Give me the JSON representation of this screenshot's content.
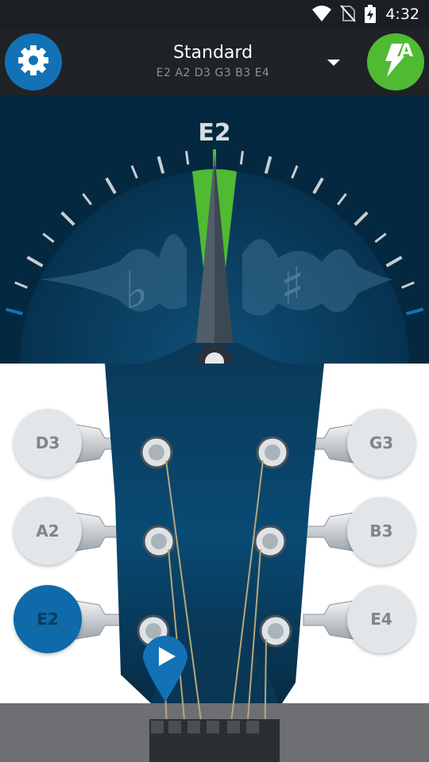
{
  "status_bar": {
    "time": "4:32",
    "icons": [
      "wifi-icon",
      "no-sim-icon",
      "battery-charging-icon"
    ]
  },
  "header": {
    "settings_icon": "gear-icon",
    "tuning_name": "Standard",
    "tuning_notes": "E2 A2 D3 G3 B3 E4",
    "dropdown_icon": "caret-down-icon",
    "auto_mode_label": "A",
    "auto_mode_icon": "lightning-icon"
  },
  "meter": {
    "target_note": "E2",
    "flat_symbol": "♭",
    "sharp_symbol": "♯",
    "in_tune_color": "#4fba32",
    "accent_color": "#1372b5"
  },
  "strings": {
    "left": [
      {
        "note": "D3",
        "active": false
      },
      {
        "note": "A2",
        "active": false
      },
      {
        "note": "E2",
        "active": true
      }
    ],
    "right": [
      {
        "note": "G3",
        "active": false
      },
      {
        "note": "B3",
        "active": false
      },
      {
        "note": "E4",
        "active": false
      }
    ]
  },
  "play_button_icon": "play-icon"
}
